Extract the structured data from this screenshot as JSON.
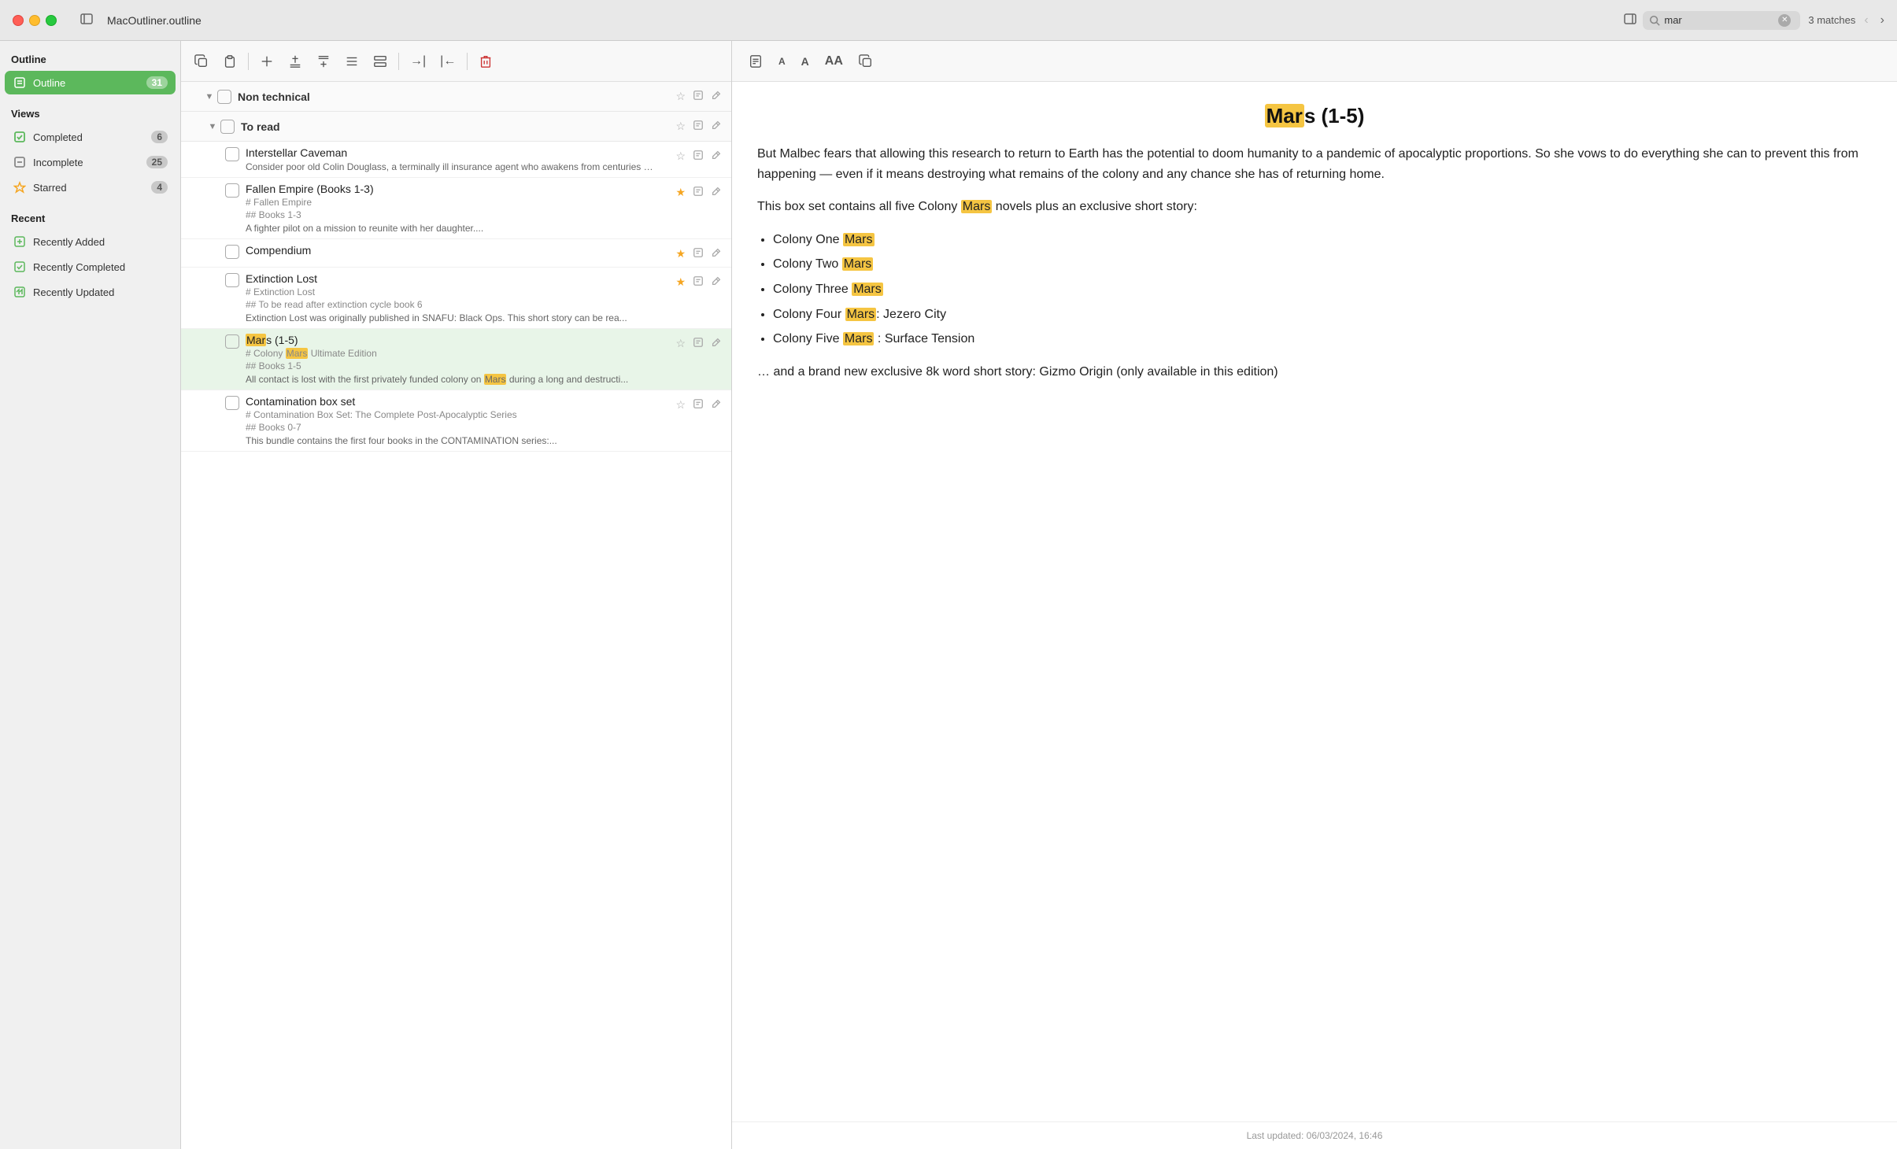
{
  "titlebar": {
    "app_name": "MacOutliner.outline",
    "search_placeholder": "mar",
    "search_value": "mar",
    "match_count": "3 matches"
  },
  "sidebar": {
    "section_outline": "Outline",
    "items_outline": [
      {
        "id": "outline",
        "label": "Outline",
        "badge": "31",
        "active": true
      }
    ],
    "section_views": "Views",
    "items_views": [
      {
        "id": "completed",
        "label": "Completed",
        "badge": "6"
      },
      {
        "id": "incomplete",
        "label": "Incomplete",
        "badge": "25"
      },
      {
        "id": "starred",
        "label": "Starred",
        "badge": "4"
      }
    ],
    "section_recent": "Recent",
    "items_recent": [
      {
        "id": "recently-added",
        "label": "Recently Added"
      },
      {
        "id": "recently-completed",
        "label": "Recently Completed"
      },
      {
        "id": "recently-updated",
        "label": "Recently Updated"
      }
    ]
  },
  "toolbar": {
    "buttons": [
      {
        "id": "copy-style",
        "icon": "⊞",
        "tooltip": "Copy style"
      },
      {
        "id": "paste-style",
        "icon": "⊟",
        "tooltip": "Paste style"
      },
      {
        "id": "add-child",
        "icon": "+↓",
        "tooltip": "Add child"
      },
      {
        "id": "add-sibling-above",
        "icon": "+↑",
        "tooltip": "Add sibling above"
      },
      {
        "id": "add-sibling-below",
        "icon": "+↓",
        "tooltip": "Add sibling below"
      },
      {
        "id": "indent-left",
        "icon": "⇤",
        "tooltip": "Indent left"
      },
      {
        "id": "indent-right",
        "icon": "⇥",
        "tooltip": "Indent right"
      },
      {
        "id": "move-right",
        "icon": "→|",
        "tooltip": "Move right"
      },
      {
        "id": "move-left",
        "icon": "|←",
        "tooltip": "Move left"
      },
      {
        "id": "delete",
        "icon": "🗑",
        "tooltip": "Delete"
      }
    ]
  },
  "outline": {
    "sections": [
      {
        "id": "non-technical",
        "label": "Non technical",
        "collapsed": false,
        "children": [
          {
            "id": "to-read",
            "label": "To read",
            "collapsed": false,
            "children": [
              {
                "id": "interstellar-caveman",
                "title": "Interstellar Caveman",
                "subtitle": "",
                "tag1": "",
                "tag2": "",
                "desc": "Consider poor old Colin Douglass, a terminally ill insurance agent who awakens from centuries in cryogenic freeze to find Earth is a devastated wasteland. Now, he's being pursued by a homicidal interstellar tourist board, and calculating insurance dividends is as outdated as making stone axes.",
                "starred": false,
                "selected": false
              },
              {
                "id": "fallen-empire",
                "title": "Fallen Empire (Books 1-3)",
                "subtitle": "# Fallen Empire",
                "tag2": "## Books 1-3",
                "desc": "A fighter pilot on a mission to reunite with her daughter....",
                "starred": true,
                "selected": false
              },
              {
                "id": "compendium",
                "title": "Compendium",
                "subtitle": "",
                "tag2": "",
                "desc": "",
                "starred": true,
                "selected": false
              },
              {
                "id": "extinction-lost",
                "title": "Extinction Lost",
                "subtitle": "# Extinction Lost",
                "tag2": "## To be read after extinction cycle book 6",
                "desc": "Extinction Lost was originally published in SNAFU: Black Ops. This short story can be rea...",
                "starred": true,
                "selected": false
              },
              {
                "id": "mars-1-5",
                "title_parts": [
                  {
                    "text": "Mar",
                    "highlight": true
                  },
                  {
                    "text": "s (1-5)",
                    "highlight": false
                  }
                ],
                "title": "Mars (1-5)",
                "subtitle": "# Colony Mars Ultimate Edition",
                "subtitle_highlight": "Mars",
                "tag2": "## Books 1-5",
                "desc": "All contact is lost with the first privately funded colony on Mars during a long and destructi...",
                "desc_highlight": "Mars",
                "starred": false,
                "selected": true
              },
              {
                "id": "contamination-box-set",
                "title": "Contamination box set",
                "subtitle": "# Contamination Box Set: The Complete Post-Apocalyptic Series",
                "tag2": "## Books 0-7",
                "desc": "This bundle contains the first four books in the CONTAMINATION series:...",
                "starred": false,
                "selected": false
              }
            ]
          }
        ]
      }
    ]
  },
  "detail": {
    "title_parts": [
      {
        "text": "Mar",
        "highlight": true
      },
      {
        "text": "s (1-5)",
        "highlight": false
      }
    ],
    "title": "Mars (1-5)",
    "body": {
      "paragraph1": "But Malbec fears that allowing this research to return to Earth has the potential to doom humanity to a pandemic of apocalyptic proportions. So she vows to do everything she can to prevent this from happening — even if it means destroying what remains of the colony and any chance she has of returning home.",
      "paragraph2": "This box set contains all five Colony Mars novels plus an exclusive short story:",
      "list": [
        {
          "text": "Colony One ",
          "highlight": "Mars"
        },
        {
          "text": "Colony Two ",
          "highlight": "Mars"
        },
        {
          "text": "Colony Three ",
          "highlight": "Mars"
        },
        {
          "text": "Colony Four ",
          "highlight": "Mars",
          "extra": ": Jezero City"
        },
        {
          "text": "Colony Five ",
          "highlight": "Mars",
          "extra": " : Surface Tension"
        }
      ],
      "paragraph3": "… and a brand new exclusive 8k word short story: Gizmo Origin (only available in this edition)"
    },
    "last_updated": "Last updated: 06/03/2024, 16:46"
  }
}
